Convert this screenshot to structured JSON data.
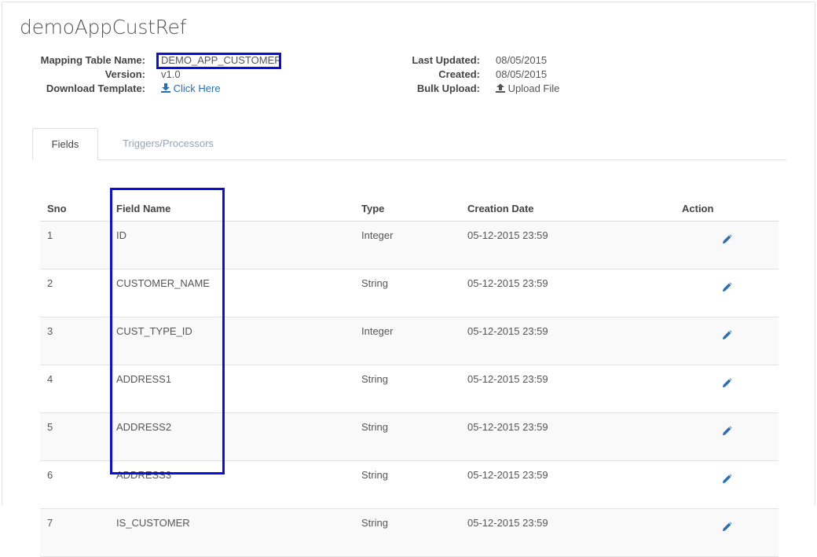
{
  "page": {
    "title": "demoAppCustRef"
  },
  "meta_left": [
    {
      "label": "Mapping Table Name:",
      "value": "DEMO_APP_CUSTOMER"
    },
    {
      "label": "Version:",
      "value": "v1.0"
    },
    {
      "label": "Download Template:",
      "value": "Click Here",
      "icon": "download-icon"
    }
  ],
  "meta_right": [
    {
      "label": "Last Updated:",
      "value": "08/05/2015"
    },
    {
      "label": "Created:",
      "value": "08/05/2015"
    },
    {
      "label": "Bulk Upload:",
      "value": "Upload File",
      "icon": "upload-icon"
    }
  ],
  "tabs": [
    {
      "label": "Fields",
      "active": true
    },
    {
      "label": "Triggers/Processors",
      "active": false
    }
  ],
  "table": {
    "headers": [
      "Sno",
      "Field Name",
      "Type",
      "Creation Date",
      "Action"
    ],
    "rows": [
      {
        "sno": "1",
        "name": "ID",
        "type": "Integer",
        "date": "05-12-2015 23:59"
      },
      {
        "sno": "2",
        "name": "CUSTOMER_NAME",
        "type": "String",
        "date": "05-12-2015 23:59"
      },
      {
        "sno": "3",
        "name": "CUST_TYPE_ID",
        "type": "Integer",
        "date": "05-12-2015 23:59"
      },
      {
        "sno": "4",
        "name": "ADDRESS1",
        "type": "String",
        "date": "05-12-2015 23:59"
      },
      {
        "sno": "5",
        "name": "ADDRESS2",
        "type": "String",
        "date": "05-12-2015 23:59"
      },
      {
        "sno": "6",
        "name": "ADDRESS3",
        "type": "String",
        "date": "05-12-2015 23:59"
      },
      {
        "sno": "7",
        "name": "IS_CUSTOMER",
        "type": "String",
        "date": "05-12-2015 23:59"
      }
    ]
  },
  "colors": {
    "link": "#2a6fb5",
    "highlight": "#0a10d8",
    "inactive_tab": "#9aa3b3"
  }
}
